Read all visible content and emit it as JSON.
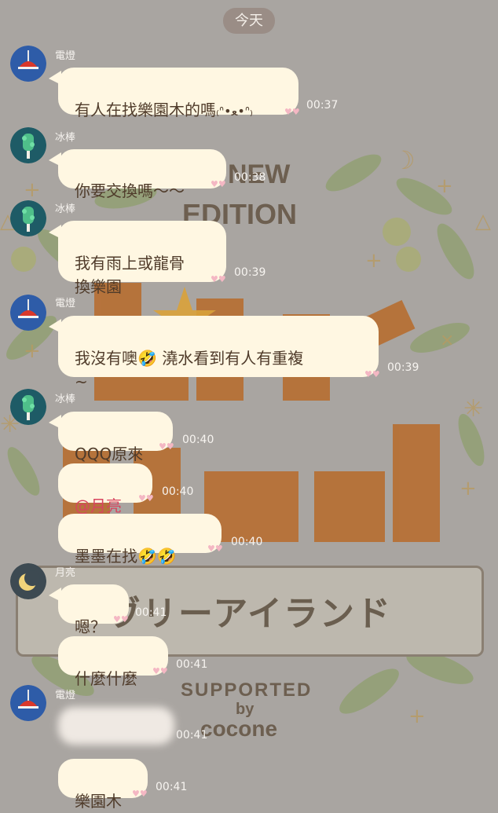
{
  "date_label": "今天",
  "background": {
    "line1": "NEW",
    "line2": "EDITION",
    "title": "Lively Island",
    "ribbon_text": "ヴリーアイランド",
    "supported": "SUPPORTED",
    "by": "by",
    "brand": "cocone"
  },
  "colors": {
    "background": "#a9a5a1",
    "bubble": "#fff7e2",
    "mention": "#d8455f",
    "text": "#4f3b2a"
  },
  "messages": [
    {
      "sender": "電燈",
      "avatar": "lamp-avatar",
      "text": "有人在找樂園木的嗎",
      "emoji": "cat-face-sticker",
      "time": "00:37"
    },
    {
      "sender": "冰棒",
      "avatar": "popsicle-avatar",
      "text": "你要交換嗎～～",
      "time": "00:38"
    },
    {
      "sender": "冰棒",
      "avatar": "popsicle-avatar",
      "text": "我有雨上或龍骨\n換樂園",
      "time": "00:39"
    },
    {
      "sender": "電燈",
      "avatar": "lamp-avatar",
      "text": "我沒有噢🤣 澆水看到有人有重複\n~",
      "time": "00:39"
    },
    {
      "sender": "冰棒",
      "avatar": "popsicle-avatar",
      "text": "QQQ原來",
      "time": "00:40"
    },
    {
      "text": "@月亮",
      "time": "00:40"
    },
    {
      "text": "墨墨在找🤣🤣",
      "time": "00:40"
    },
    {
      "sender": "月亮",
      "avatar": "moon-avatar",
      "text": "嗯？",
      "time": "00:41"
    },
    {
      "text": "什麼什麼",
      "time": "00:41"
    },
    {
      "sender": "電燈",
      "avatar": "lamp-avatar",
      "text": "",
      "blurred": true,
      "time": "00:41"
    },
    {
      "text": "樂園木",
      "time": "00:41"
    }
  ]
}
